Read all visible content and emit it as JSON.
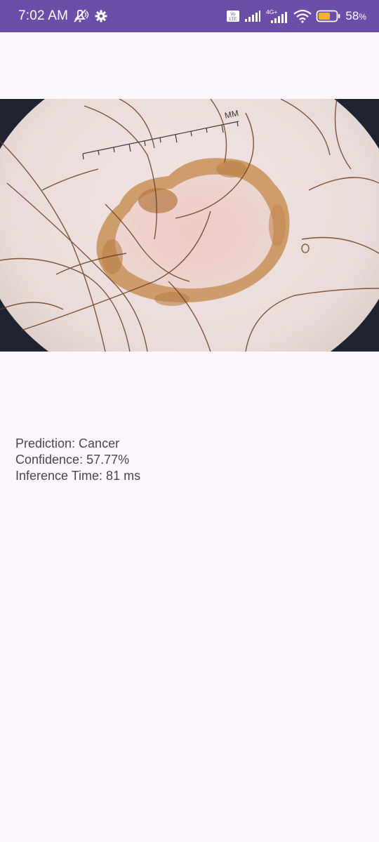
{
  "status_bar": {
    "time": "7:02 AM",
    "battery_percent": "58",
    "battery_suffix": "%",
    "network_label": "4G+",
    "volte_label": "Vo LTE",
    "icons": [
      "silent-mode-icon",
      "settings-gear-icon",
      "volte-icon",
      "signal-icon",
      "signal-4g-icon",
      "wifi-icon",
      "battery-icon"
    ],
    "bar_color": "#6a4ea8",
    "battery_fill_color": "#f2b230"
  },
  "image": {
    "description_icon": "dermoscopy-image",
    "ruler_label": "MM"
  },
  "results": {
    "prediction": "Prediction: Cancer",
    "confidence": "Confidence: 57.77%",
    "inference_time": "Inference Time: 81 ms"
  },
  "colors": {
    "background": "#fdf7fd",
    "text": "#4a4550"
  }
}
